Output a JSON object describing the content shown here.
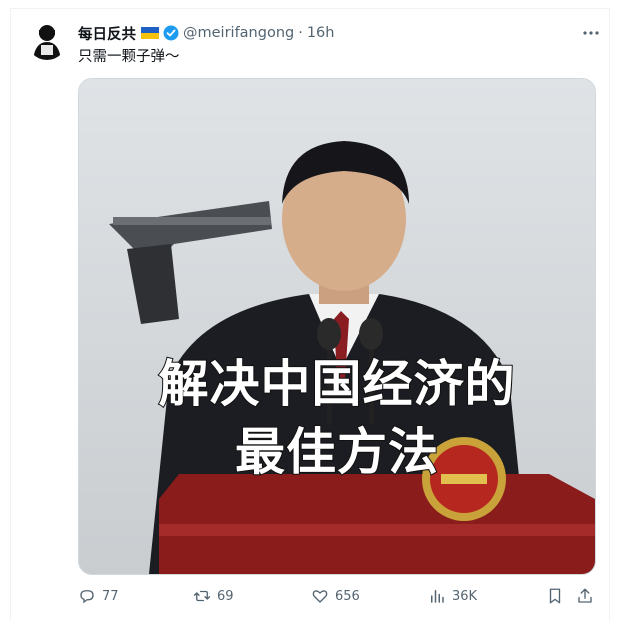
{
  "tweet": {
    "display_name": "每日反共",
    "flag_icon": "ukraine-flag-icon",
    "verified_icon": "verified-badge-icon",
    "handle": "@meirifangong",
    "separator": "·",
    "time": "16h",
    "caption": "只需一颗子弹～",
    "more_icon": "more-dots-icon"
  },
  "media": {
    "overlay_line1": "解决中国经济的",
    "overlay_line2": "最佳方法"
  },
  "actions": {
    "reply": {
      "icon": "reply-icon",
      "count": "77"
    },
    "retweet": {
      "icon": "retweet-icon",
      "count": "69"
    },
    "like": {
      "icon": "heart-icon",
      "count": "656"
    },
    "views": {
      "icon": "views-bar-icon",
      "count": "36K"
    },
    "bookmark": {
      "icon": "bookmark-icon"
    },
    "share": {
      "icon": "share-icon"
    }
  },
  "colors": {
    "text": "#0f1419",
    "muted": "#536471",
    "verified": "#1d9bf0",
    "border": "#cfd9de"
  }
}
